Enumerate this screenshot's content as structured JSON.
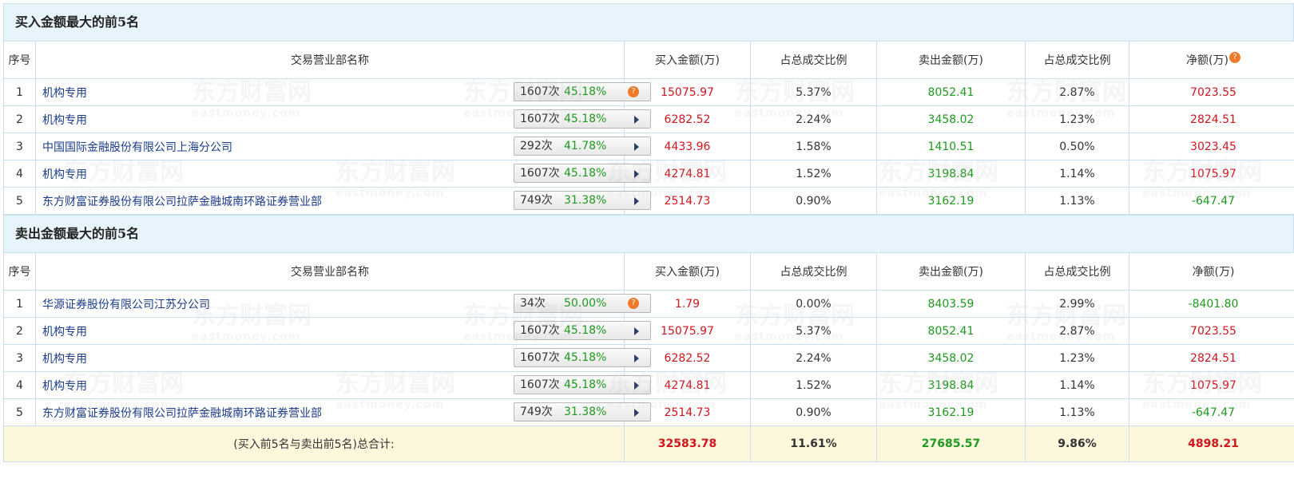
{
  "buy_section": {
    "title": "买入金额最大的前5名",
    "headers": [
      "序号",
      "交易营业部名称",
      "买入金额(万)",
      "占总成交比例",
      "卖出金额(万)",
      "占总成交比例",
      "净额(万)"
    ],
    "rows": [
      {
        "idx": "1",
        "name": "机构专用",
        "count": "1607次",
        "pct": "45.18%",
        "icon": "question",
        "buy": "15075.97",
        "buy_ratio": "5.37%",
        "sell": "8052.41",
        "sell_ratio": "2.87%",
        "net": "7023.55",
        "net_color": "red"
      },
      {
        "idx": "2",
        "name": "机构专用",
        "count": "1607次",
        "pct": "45.18%",
        "icon": "arrow",
        "buy": "6282.52",
        "buy_ratio": "2.24%",
        "sell": "3458.02",
        "sell_ratio": "1.23%",
        "net": "2824.51",
        "net_color": "red"
      },
      {
        "idx": "3",
        "name": "中国国际金融股份有限公司上海分公司",
        "count": "292次",
        "pct": "41.78%",
        "icon": "arrow",
        "buy": "4433.96",
        "buy_ratio": "1.58%",
        "sell": "1410.51",
        "sell_ratio": "0.50%",
        "net": "3023.45",
        "net_color": "red"
      },
      {
        "idx": "4",
        "name": "机构专用",
        "count": "1607次",
        "pct": "45.18%",
        "icon": "arrow",
        "buy": "4274.81",
        "buy_ratio": "1.52%",
        "sell": "3198.84",
        "sell_ratio": "1.14%",
        "net": "1075.97",
        "net_color": "red"
      },
      {
        "idx": "5",
        "name": "东方财富证券股份有限公司拉萨金融城南环路证券营业部",
        "count": "749次",
        "pct": "31.38%",
        "icon": "arrow",
        "buy": "2514.73",
        "buy_ratio": "0.90%",
        "sell": "3162.19",
        "sell_ratio": "1.13%",
        "net": "-647.47",
        "net_color": "green"
      }
    ]
  },
  "sell_section": {
    "title": "卖出金额最大的前5名",
    "headers": [
      "序号",
      "交易营业部名称",
      "买入金额(万)",
      "占总成交比例",
      "卖出金额(万)",
      "占总成交比例",
      "净额(万)"
    ],
    "rows": [
      {
        "idx": "1",
        "name": "华源证券股份有限公司江苏分公司",
        "count": "34次",
        "pct": "50.00%",
        "icon": "question",
        "buy": "1.79",
        "buy_ratio": "0.00%",
        "sell": "8403.59",
        "sell_ratio": "2.99%",
        "net": "-8401.80",
        "net_color": "green"
      },
      {
        "idx": "2",
        "name": "机构专用",
        "count": "1607次",
        "pct": "45.18%",
        "icon": "arrow",
        "buy": "15075.97",
        "buy_ratio": "5.37%",
        "sell": "8052.41",
        "sell_ratio": "2.87%",
        "net": "7023.55",
        "net_color": "red"
      },
      {
        "idx": "3",
        "name": "机构专用",
        "count": "1607次",
        "pct": "45.18%",
        "icon": "arrow",
        "buy": "6282.52",
        "buy_ratio": "2.24%",
        "sell": "3458.02",
        "sell_ratio": "1.23%",
        "net": "2824.51",
        "net_color": "red"
      },
      {
        "idx": "4",
        "name": "机构专用",
        "count": "1607次",
        "pct": "45.18%",
        "icon": "arrow",
        "buy": "4274.81",
        "buy_ratio": "1.52%",
        "sell": "3198.84",
        "sell_ratio": "1.14%",
        "net": "1075.97",
        "net_color": "red"
      },
      {
        "idx": "5",
        "name": "东方财富证券股份有限公司拉萨金融城南环路证券营业部",
        "count": "749次",
        "pct": "31.38%",
        "icon": "arrow",
        "buy": "2514.73",
        "buy_ratio": "0.90%",
        "sell": "3162.19",
        "sell_ratio": "1.13%",
        "net": "-647.47",
        "net_color": "green"
      }
    ],
    "total": {
      "label": "(买入前5名与卖出前5名)总合计:",
      "buy": "32583.78",
      "buy_ratio": "11.61%",
      "sell": "27685.57",
      "sell_ratio": "9.86%",
      "net": "4898.21"
    }
  },
  "watermark": {
    "text": "东方财富网",
    "sub": "eastmoney.com"
  },
  "colors": {
    "red": "#d2141e",
    "green": "#1e9a1e",
    "header_bg": "#e8f4fb",
    "total_bg": "#fdf7dc",
    "border": "#c8dff0",
    "help_icon": "#f07a2a"
  },
  "icons": {
    "help": "question-circle-icon",
    "expand": "triangle-right-icon"
  }
}
